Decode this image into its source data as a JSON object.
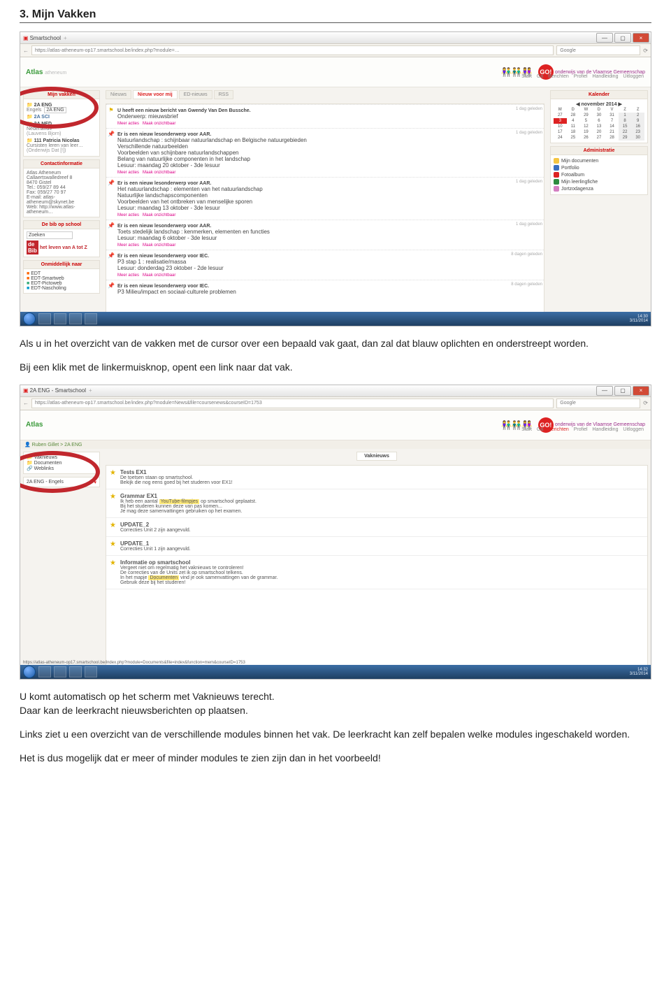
{
  "doc": {
    "heading": "3. Mijn Vakken",
    "para1": "Als u in het overzicht van de vakken met de cursor over een bepaald vak gaat, dan zal dat blauw oplichten en onderstreept worden.",
    "para2": "Bij een klik met de linkermuisknop, opent een link naar dat vak.",
    "para3": "U komt automatisch op het scherm met Vaknieuws terecht.",
    "para4": "Daar kan de leerkracht nieuwsberichten op plaatsen.",
    "para5": "Links ziet u een overzicht van de verschillende modules binnen het vak. De leerkracht kan zelf bepalen welke modules ingeschakeld worden.",
    "para6": "Het is dus mogelijk dat er meer of minder modules te zien zijn dan in het voorbeeld!"
  },
  "shared": {
    "win_tab": "Smartschool",
    "min": "—",
    "max": "▢",
    "close": "×",
    "back": "←",
    "home": "⟳",
    "search_engine": "Google",
    "brand": "Atlas",
    "brand_sub": "atheneum",
    "go": "GO!",
    "go_sub": "onderwijs van de Vlaamse Gemeenschap",
    "nav_start": "Start",
    "nav_ga": "Ga",
    "nav_ber": "Berichten",
    "nav_prof": "Profiel",
    "nav_hand": "Handleiding",
    "nav_uit": "Uitloggen",
    "task_time": "14:30",
    "task_date": "3/11/2014"
  },
  "s1": {
    "url": "https://atlas-atheneum-op17.smartschool.be/index.php?module=…",
    "vakken_title": "Mijn vakken",
    "vak1": "2A ENG",
    "vak1_sub": "Engels",
    "vak1_badge": "2A ENG",
    "vak2": "2A SCI",
    "vak3": "2A NED",
    "vak3_sub": "Nederlands",
    "vak3_teacher": "(Lauvens Bjorn)",
    "vak4": "111 Patricia Nicolas",
    "vak4_sub": "Cursisten leren van leer…",
    "vak4_extra": "(Onderwijs Dat [!])",
    "contact_title": "Contactinformatie",
    "contact_body": "Atlas Atheneum\nCallaertswalledreef 8\n8470 Gistel\nTel.: 059/27 89 44\nFax: 059/27 70 97\nE-mail: atlas-atheneum@skynet.be\nWeb: http://www.atlas-atheneum…",
    "bib_title": "De bib op school",
    "bib_search": "Zoeken",
    "bib_tag": "het leven van A tot Z",
    "links_title": "Onmiddellijk naar",
    "l1": "EDT",
    "l2": "EDT-Smartweb",
    "l3": "EDT-Pictoweb",
    "l4": "EDT-Nascholing",
    "tabs": {
      "t1": "Nieuws",
      "t2": "Nieuw voor mij",
      "t3": "ED-nieuws",
      "t4": "RSS"
    },
    "entry_meta": "1 dag geleden",
    "entry_meta2": "8 dagen geleden",
    "f1_title": "U heeft een nieuw bericht van Gwendy Van Den Bussche.",
    "f1_sub": "Onderwerp: mieuwsbrief",
    "f2_title": "Er is een nieuw lesonderwerp voor AAR.",
    "f2_l1": "Natuurlandschap : schijnbaar natuurlandschap en Belgische natuurgebieden",
    "f2_l2": "Verschillende natuurbeelden",
    "f2_l3": "Voorbeelden van schijnbare natuurlandschappen",
    "f2_l4": "Belang van natuurlijke componenten in het landschap",
    "f2_l5": "Lesuur: maandag 20 oktober - 3de lesuur",
    "f3_title": "Er is een nieuw lesonderwerp voor AAR.",
    "f3_l1": "Het natuurlandschap : elementen van het natuurlandschap",
    "f3_l2": "Natuurlijke landschapscomponenten",
    "f3_l3": "Voorbeelden van het ontbreken van menselijke sporen",
    "f3_l4": "Lesuur: maandag 13 oktober - 3de lesuur",
    "f4_title": "Er is een nieuw lesonderwerp voor AAR.",
    "f4_l1": "Toets stedelijk landschap : kenmerken, elementen en functies",
    "f4_l2": "Lesuur: maandag 6 oktober - 3de lesuur",
    "f5_title": "Er is een nieuw lesonderwerp voor IEC.",
    "f5_l1": "P3 stap 1 : realisatie/massa",
    "f5_l2": "Lesuur: donderdag 23 oktober - 2de lesuur",
    "f6_title": "Er is een nieuw lesonderwerp voor IEC.",
    "f6_l1": "P3 Milieu/impact en sociaal-culturele problemen",
    "more": "Meer acties",
    "hide": "Maak onzichtbaar",
    "cal_title": "Kalender",
    "cal_month": "november 2014",
    "cal_days": [
      "M",
      "D",
      "W",
      "D",
      "V",
      "Z",
      "Z"
    ],
    "admin_title": "Administratie",
    "a1": "Mijn documenten",
    "a2": "Portfolio",
    "a3": "Fotoalbum",
    "a4": "Mijn leerlingfiche",
    "a5": "Jortzodagenza"
  },
  "s2": {
    "tab": "2A ENG - Smartschool",
    "url": "https://atlas-atheneum-op17.smartschool.be/index.php?module=News&file=coursenews&courseID=1753",
    "crumb": "Ruben Gillet > 2A ENG",
    "m1": "Vaknieuws",
    "m2": "Documenten",
    "m3": "Weblinks",
    "sel": "2A ENG - Engels",
    "tab_center": "Vaknieuws",
    "n1_t": "Tests EX1",
    "n1_a": "De toetsen staan op smartschool.",
    "n1_b": "Bekijk die nog eens goed bij het studeren voor EX1!",
    "n2_t": "Grammar EX1",
    "n2_a": "Ik heb een aantal",
    "n2_h": "YouTube-filmpjes",
    "n2_b": "op smartschool geplaatst.",
    "n2_c": "Bij het studeren kunnen deze van pas komen...",
    "n2_d": "Je mag deze samenvattingen gebruiken op het examen.",
    "n3_t": "UPDATE_2",
    "n3_a": "Correcties Unit 2 zijn aangevuld.",
    "n4_t": "UPDATE_1",
    "n4_a": "Correcties Unit 1 zijn aangevuld.",
    "n5_t": "Informatie op smartschool",
    "n5_a": "Vergeet niet om regelmatig het vaknieuws te controleren!",
    "n5_b": "De correcties van de Units zet ik op smartschool telkens.",
    "n5_c": "In het mapje",
    "n5_h": "Documenten",
    "n5_d": "vind je ook samenvattingen van de grammar.",
    "n5_e": "Gebruik deze bij het studeren!",
    "status_url": "https://atlas-atheneum-op17.smartschool.be/index.php?module=Documents&file=index&function=mem&courseID=1753",
    "task_time": "14:32"
  }
}
